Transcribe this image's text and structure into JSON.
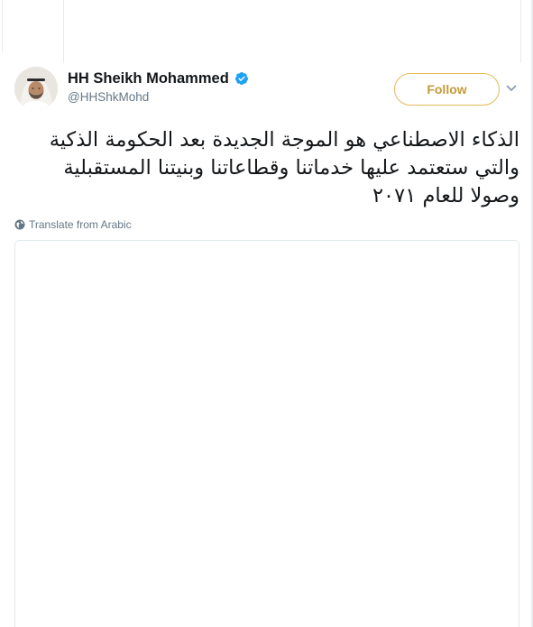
{
  "tweet": {
    "author": {
      "fullname": "HH Sheikh Mohammed",
      "handle": "@HHShkMohd",
      "verified": true,
      "avatar_icon": "profile-photo"
    },
    "follow_label": "Follow",
    "text": "الذكاء الاصطناعي هو الموجة الجديدة بعد الحكومة الذكية والتي ستعتمد عليها خدماتنا وقطاعاتنا وبنيتنا المستقبلية وصولا للعام ٢٠٧١",
    "translate_label": "Translate from Arabic"
  },
  "colors": {
    "follow_accent": "#c69a3a",
    "verified_blue": "#1da1f2",
    "text_primary": "#14171a",
    "text_secondary": "#657786",
    "border": "#e1e8ed"
  }
}
